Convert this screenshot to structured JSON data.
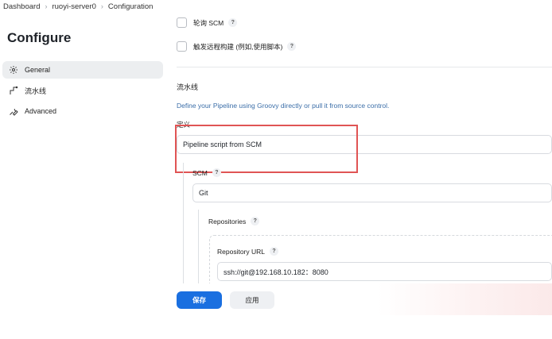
{
  "breadcrumb": {
    "items": [
      "Dashboard",
      "ruoyi-server0",
      "Configuration"
    ]
  },
  "page_title": "Configure",
  "sidebar": {
    "items": [
      {
        "label": "General",
        "icon": "gear-icon",
        "active": true
      },
      {
        "label": "流水线",
        "icon": "pipeline-icon",
        "active": false
      },
      {
        "label": "Advanced",
        "icon": "wrench-icon",
        "active": false
      }
    ]
  },
  "triggers": {
    "poll_scm_label": "轮询 SCM",
    "remote_trigger_label": "触发远程构建 (例如,使用脚本)"
  },
  "pipeline": {
    "section_title": "流水线",
    "description": "Define your Pipeline using Groovy directly or pull it from source control.",
    "definition_label": "定义",
    "definition_value": "Pipeline script from SCM",
    "scm_label": "SCM",
    "scm_value": "Git",
    "repositories_label": "Repositories",
    "repository_url_label": "Repository URL",
    "repository_url_value": "ssh://git@192.168.10.182：8080"
  },
  "help_glyph": "?",
  "buttons": {
    "save": "保存",
    "apply": "应用"
  },
  "colors": {
    "primary": "#1a6fe0",
    "highlight": "#e05454",
    "link_text": "#3b6ea8"
  }
}
